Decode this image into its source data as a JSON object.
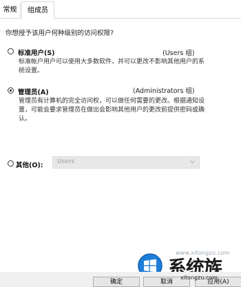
{
  "tabs": [
    {
      "label": "常规",
      "active": false
    },
    {
      "label": "组成员",
      "active": true
    }
  ],
  "question": "你想授予该用户何种级别的访问权限?",
  "options": [
    {
      "label": "标准用户(S)",
      "group": "(Users 组)",
      "description": "标准帐户用户可以使用大多数软件，并可以更改不影响其他用户的系统设置。",
      "checked": false
    },
    {
      "label": "管理员(A)",
      "group": "(Administrators 组)",
      "description": "管理员有计算机的完全访问权，可以做任何需要的更改。根据通知设置，可能会要求管理员在做出会影响其他用户的更改前提供密码或确认。",
      "checked": true
    },
    {
      "label": "其他(O):",
      "checked": false
    }
  ],
  "other_select": {
    "value": "Users",
    "disabled": true
  },
  "buttons": {
    "ok": "确定",
    "cancel": "取消",
    "apply": "应用(A)"
  },
  "watermark": {
    "url_top": "www.xitongzu.com",
    "brand": "系统族",
    "url_bottom": "xitongzu.com"
  },
  "colors": {
    "tab_border": "#d9d9d9",
    "select_bg": "#e8e8e8",
    "logo_blue": "#1e7fd8"
  }
}
